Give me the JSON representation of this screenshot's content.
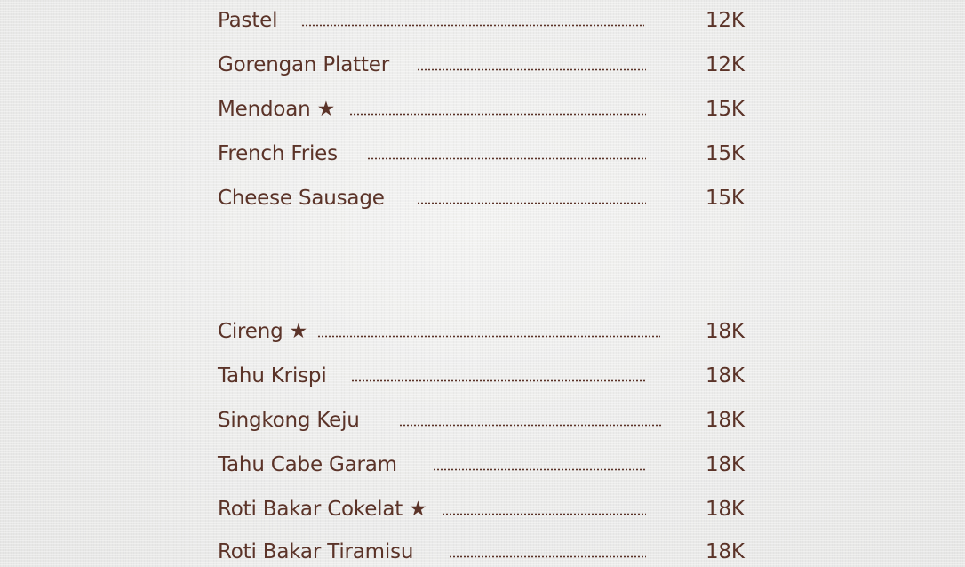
{
  "sections": [
    {
      "items": [
        {
          "name": "Pastel",
          "price": "12K"
        },
        {
          "name": "Gorengan Platter",
          "price": "12K"
        },
        {
          "name": "Mendoan ★",
          "price": "15K"
        },
        {
          "name": "French Fries",
          "price": "15K"
        },
        {
          "name": "Cheese Sausage",
          "price": "15K"
        }
      ]
    },
    {
      "items": [
        {
          "name": "Cireng ★",
          "price": "18K"
        },
        {
          "name": "Tahu Krispi",
          "price": "18K"
        },
        {
          "name": "Singkong Keju",
          "price": "18K"
        },
        {
          "name": "Tahu Cabe Garam",
          "price": "18K"
        },
        {
          "name": "Roti Bakar Cokelat ★",
          "price": "18K"
        },
        {
          "name": "Roti Bakar Tiramisu",
          "price": "18K"
        }
      ]
    }
  ],
  "colors": {
    "text": "#5b3328",
    "background": "#ececeb"
  }
}
